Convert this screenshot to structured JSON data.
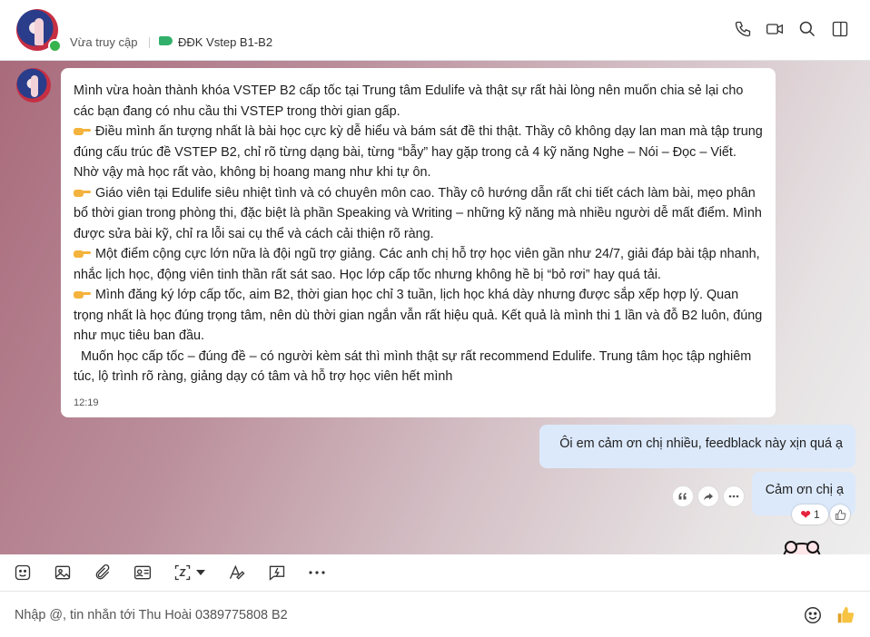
{
  "header": {
    "last_seen": "Vừa truy cập",
    "tag_label": "ĐĐK Vstep B1-B2",
    "icons": [
      "phone-icon",
      "video-call-icon",
      "search-icon",
      "sidebar-toggle-icon"
    ]
  },
  "messages": {
    "incoming": {
      "paragraphs": [
        "Mình vừa hoàn thành khóa VSTEP B2 cấp tốc tại Trung tâm Edulife và thật sự rất hài lòng nên muốn chia sẻ lại cho các bạn đang có nhu cầu thi VSTEP trong thời gian gấp.",
        "Điều mình ấn tượng nhất là bài học cực kỳ dễ hiểu và bám sát đề thi thật. Thầy cô không dạy lan man mà tập trung đúng cấu trúc đề VSTEP B2, chỉ rõ từng dạng bài, từng “bẫy” hay gặp trong cả 4 kỹ năng Nghe – Nói – Đọc – Viết. Nhờ vậy mà học rất vào, không bị hoang mang như khi tự ôn.",
        "Giáo viên tại Edulife siêu nhiệt tình và có chuyên môn cao. Thầy cô hướng dẫn rất chi tiết cách làm bài, mẹo phân bổ thời gian trong phòng thi, đặc biệt là phần Speaking và Writing – những kỹ năng mà nhiều người dễ mất điểm. Mình được sửa bài kỹ, chỉ ra lỗi sai cụ thể và cách cải thiện rõ ràng.",
        "Một điểm cộng cực lớn nữa là đội ngũ trợ giảng. Các anh chị hỗ trợ học viên gần như 24/7, giải đáp bài tập nhanh, nhắc lịch học, động viên tinh thần rất sát sao. Học lớp cấp tốc nhưng không hề bị “bỏ rơi” hay quá tải.",
        "Mình đăng ký lớp cấp tốc, aim B2, thời gian học chỉ 3 tuần, lịch học khá dày nhưng được sắp xếp hợp lý. Quan trọng nhất là học đúng trọng tâm, nên dù thời gian ngắn vẫn rất hiệu quả. Kết quả là mình thi 1 lần và đỗ B2 luôn, đúng như mục tiêu ban đầu.",
        "  Muốn học cấp tốc – đúng đề – có người kèm sát thì mình thật sự rất recommend Edulife. Trung tâm học tập nghiêm túc, lộ trình rõ ràng, giảng dạy có tâm và hỗ trợ học viên hết mình"
      ],
      "time": "12:19"
    },
    "outgoing": [
      "Ôi em cảm ơn chị nhiều, feedblack này xịn quá ạ",
      "Cảm ơn chị ạ"
    ],
    "reaction_count": "1",
    "actions": [
      "quote-icon",
      "forward-icon",
      "more-icon"
    ]
  },
  "toolbar": {
    "icons": [
      "sticker-icon",
      "image-icon",
      "attach-icon",
      "contact-card-icon",
      "screenshot-icon",
      "chevron-down-icon",
      "text-format-icon",
      "quick-message-icon",
      "more-icon"
    ]
  },
  "composer": {
    "placeholder": "Nhập @, tin nhắn tới Thu Hoài 0389775808 B2"
  },
  "colors": {
    "accent_blue": "#dce9fb",
    "online_green": "#37b24d",
    "tag_green": "#32b06b",
    "pointing_hand": "#f4b33d",
    "heart": "#e5233c"
  }
}
